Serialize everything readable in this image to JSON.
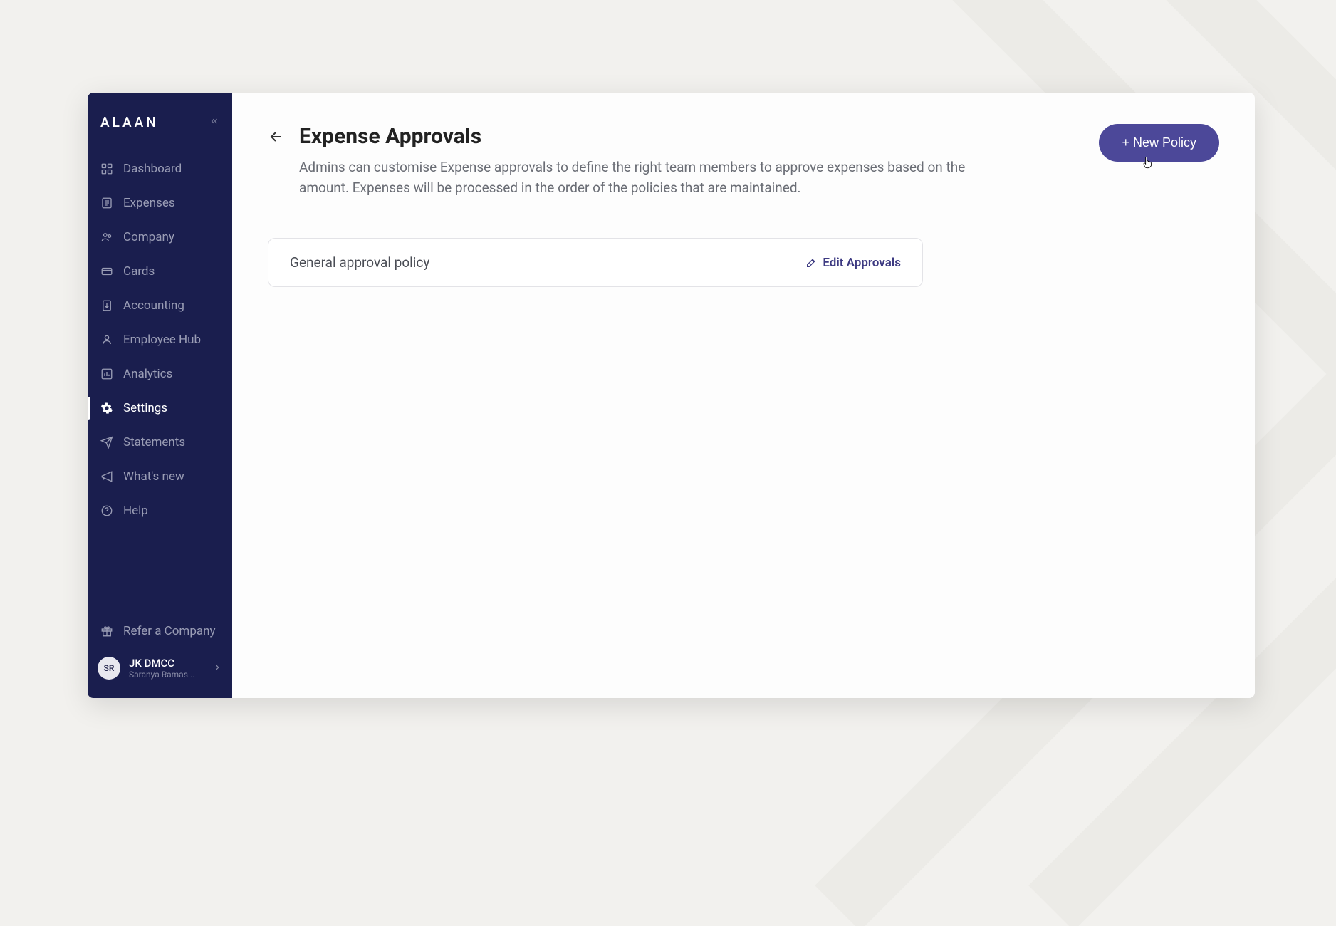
{
  "brand": "ALAAN",
  "sidebar": {
    "items": [
      {
        "label": "Dashboard",
        "icon": "dashboard-icon"
      },
      {
        "label": "Expenses",
        "icon": "expenses-icon"
      },
      {
        "label": "Company",
        "icon": "company-icon"
      },
      {
        "label": "Cards",
        "icon": "cards-icon"
      },
      {
        "label": "Accounting",
        "icon": "accounting-icon"
      },
      {
        "label": "Employee Hub",
        "icon": "employee-icon"
      },
      {
        "label": "Analytics",
        "icon": "analytics-icon"
      },
      {
        "label": "Settings",
        "icon": "settings-icon",
        "active": true
      },
      {
        "label": "Statements",
        "icon": "statements-icon"
      },
      {
        "label": "What's new",
        "icon": "whatsnew-icon"
      },
      {
        "label": "Help",
        "icon": "help-icon"
      }
    ],
    "refer_label": "Refer a Company",
    "account": {
      "initials": "SR",
      "company": "JK DMCC",
      "user": "Saranya Ramas..."
    }
  },
  "page": {
    "title": "Expense Approvals",
    "description": "Admins can customise Expense approvals to define the right team members to approve expenses based on the amount. Expenses will be processed in the order of the policies that are maintained.",
    "new_policy_label": "+ New Policy"
  },
  "policies": [
    {
      "name": "General approval policy",
      "edit_label": "Edit Approvals"
    }
  ]
}
